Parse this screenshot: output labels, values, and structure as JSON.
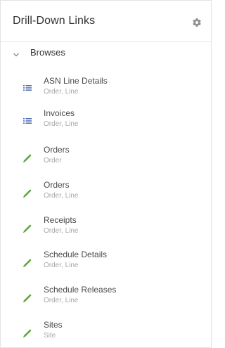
{
  "panel": {
    "title": "Drill-Down Links",
    "settings_icon": "gear-icon"
  },
  "section": {
    "label": "Browses",
    "expanded": true,
    "icon": "chevron-down-icon"
  },
  "colors": {
    "list_icon": "#4e6fb3",
    "pencil_icon": "#5da63c",
    "text": "#4a4a4a",
    "subtext": "#a7a7a7"
  },
  "items": [
    {
      "name": "ASN Line Details",
      "sub": "Order, Line",
      "icon": "list-icon"
    },
    {
      "name": "Invoices",
      "sub": "Order, Line",
      "icon": "list-icon"
    },
    {
      "name": "Orders",
      "sub": "Order",
      "icon": "pencil-icon"
    },
    {
      "name": "Orders",
      "sub": "Order, Line",
      "icon": "pencil-icon"
    },
    {
      "name": "Receipts",
      "sub": "Order, Line",
      "icon": "pencil-icon"
    },
    {
      "name": "Schedule Details",
      "sub": "Order, Line",
      "icon": "pencil-icon"
    },
    {
      "name": "Schedule Releases",
      "sub": "Order, Line",
      "icon": "pencil-icon"
    },
    {
      "name": "Sites",
      "sub": "Site",
      "icon": "pencil-icon"
    }
  ]
}
